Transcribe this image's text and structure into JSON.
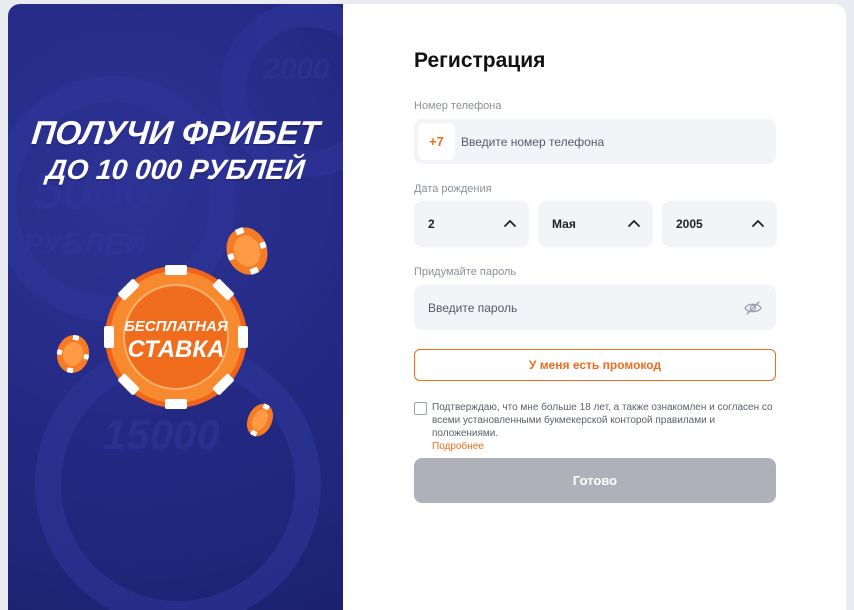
{
  "promo": {
    "headline_line1": "ПОЛУЧИ ФРИБЕТ",
    "headline_line2": "ДО 10 000 РУБЛЕЙ",
    "chip_text_line1": "БЕСПЛАТНАЯ",
    "chip_text_line2": "СТАВКА",
    "bg_watermark_1": "2000",
    "bg_watermark_2": "5000",
    "bg_watermark_3": "РУБЛЕЙ",
    "bg_watermark_4": "15000",
    "colors": {
      "panel": "#252b86",
      "chip": "#f26a1b"
    }
  },
  "form": {
    "title": "Регистрация",
    "phone": {
      "label": "Номер телефона",
      "prefix": "+7",
      "placeholder": "Введите номер телефона"
    },
    "birthdate": {
      "label": "Дата рождения",
      "day": "2",
      "month": "Мая",
      "year": "2005"
    },
    "password": {
      "label": "Придумайте пароль",
      "placeholder": "Введите пароль"
    },
    "promo_button": "У меня есть промокод",
    "consent_text": "Подтверждаю, что мне больше 18 лет, а также ознакомлен и согласен со всеми установленными букмекерской конторой правилами и положениями.",
    "consent_link": "Подробнее",
    "submit": "Готово",
    "accent_color": "#f26a1b",
    "icons": {
      "select": "chevron-up-icon",
      "password": "eye-slash-icon"
    }
  }
}
